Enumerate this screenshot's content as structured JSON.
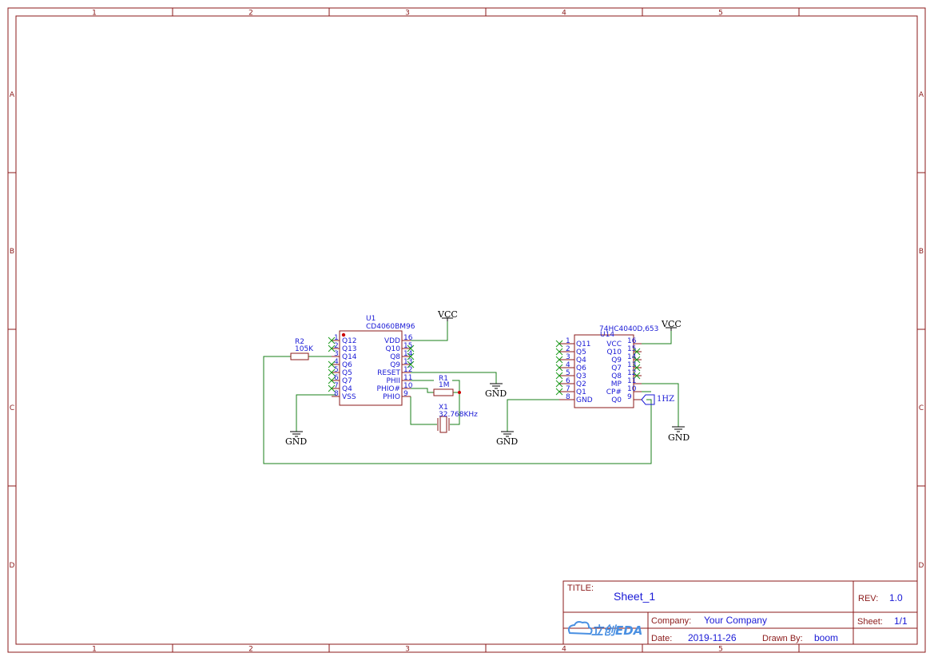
{
  "sheet": {
    "col_labels": [
      "1",
      "2",
      "3",
      "4",
      "5"
    ],
    "row_labels": [
      "A",
      "B",
      "C",
      "D"
    ]
  },
  "title_block": {
    "title_caption": "TITLE:",
    "title_value": "Sheet_1",
    "rev_caption": "REV:",
    "rev_value": "1.0",
    "company_caption": "Company:",
    "company_value": "Your Company",
    "sheet_caption": "Sheet:",
    "sheet_value": "1/1",
    "date_caption": "Date:",
    "date_value": "2019-11-26",
    "drawn_caption": "Drawn By:",
    "drawn_value": "boom",
    "logo_text": "立创EDA"
  },
  "u1": {
    "designator": "U1",
    "part": "CD4060BM96",
    "left_pins": [
      {
        "num": "1",
        "name": "Q12"
      },
      {
        "num": "2",
        "name": "Q13"
      },
      {
        "num": "3",
        "name": "Q14"
      },
      {
        "num": "4",
        "name": "Q6"
      },
      {
        "num": "5",
        "name": "Q5"
      },
      {
        "num": "6",
        "name": "Q7"
      },
      {
        "num": "7",
        "name": "Q4"
      },
      {
        "num": "8",
        "name": "VSS"
      }
    ],
    "right_pins": [
      {
        "num": "16",
        "name": "VDD"
      },
      {
        "num": "15",
        "name": "Q10"
      },
      {
        "num": "14",
        "name": "Q8"
      },
      {
        "num": "13",
        "name": "Q9"
      },
      {
        "num": "12",
        "name": "RESET"
      },
      {
        "num": "11",
        "name": "PHII"
      },
      {
        "num": "10",
        "name": "PHIO#"
      },
      {
        "num": "9",
        "name": "PHIO"
      }
    ]
  },
  "u14": {
    "designator": "U14",
    "part": "74HC4040D,653",
    "left_pins": [
      {
        "num": "1",
        "name": "Q11"
      },
      {
        "num": "2",
        "name": "Q5"
      },
      {
        "num": "3",
        "name": "Q4"
      },
      {
        "num": "4",
        "name": "Q6"
      },
      {
        "num": "5",
        "name": "Q3"
      },
      {
        "num": "6",
        "name": "Q2"
      },
      {
        "num": "7",
        "name": "Q1"
      },
      {
        "num": "8",
        "name": "GND"
      }
    ],
    "right_pins": [
      {
        "num": "16",
        "name": "VCC"
      },
      {
        "num": "15",
        "name": "Q10"
      },
      {
        "num": "14",
        "name": "Q9"
      },
      {
        "num": "13",
        "name": "Q7"
      },
      {
        "num": "12",
        "name": "Q8"
      },
      {
        "num": "11",
        "name": "MP"
      },
      {
        "num": "10",
        "name": "CP#"
      },
      {
        "num": "9",
        "name": "Q0"
      }
    ]
  },
  "r2": {
    "designator": "R2",
    "value": "105K"
  },
  "r1": {
    "designator": "R1",
    "value": "1M"
  },
  "x1": {
    "designator": "X1",
    "value": "32.768KHz"
  },
  "nets": {
    "vcc1": "VCC",
    "vcc2": "VCC",
    "gnd1": "GND",
    "gnd2": "GND",
    "gnd3": "GND",
    "gnd4": "GND",
    "port": "1HZ"
  },
  "colors": {
    "frame": "#8b1a1a",
    "wire": "#1a7f1a",
    "text": "#1a1ad6"
  }
}
